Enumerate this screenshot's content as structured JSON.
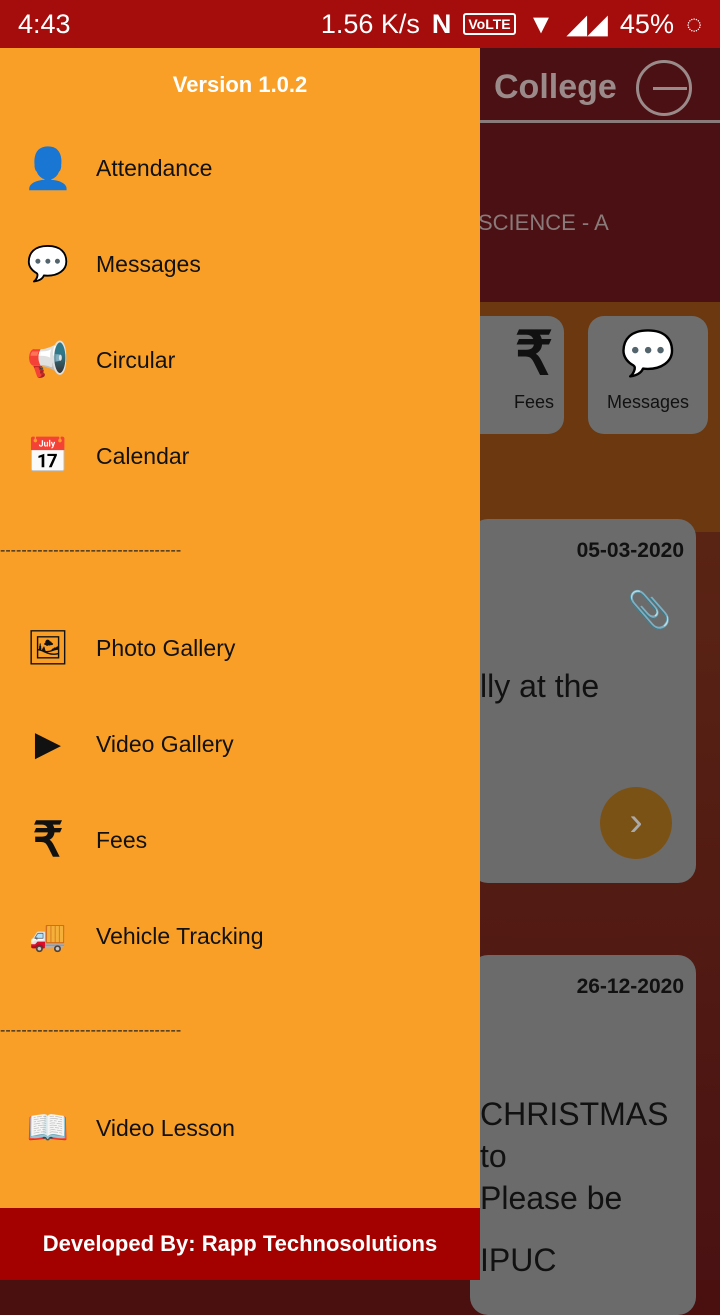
{
  "status_bar": {
    "time": "4:43",
    "net_speed": "1.56 K/s",
    "nfc": "N",
    "volte": "VoLTE",
    "battery": "45%"
  },
  "background": {
    "title": "College",
    "class_label": "SCIENCE - A",
    "tiles": [
      {
        "label": "Fees",
        "icon": "rupee-icon"
      },
      {
        "label": "Messages",
        "icon": "messages-icon"
      }
    ],
    "cards": [
      {
        "date": "05-03-2020",
        "text": "lly at the"
      },
      {
        "date": "26-12-2020",
        "lines": [
          "CHRISTMAS",
          "to",
          "Please be",
          "IPUC"
        ]
      }
    ]
  },
  "drawer": {
    "version": "Version 1.0.2",
    "group1": [
      {
        "label": "Attendance",
        "icon": "attendance-icon"
      },
      {
        "label": "Messages",
        "icon": "messages-icon"
      },
      {
        "label": "Circular",
        "icon": "megaphone-icon"
      },
      {
        "label": "Calendar",
        "icon": "calendar-icon"
      }
    ],
    "separator": "----------------------------------",
    "group2": [
      {
        "label": "Photo Gallery",
        "icon": "photo-gallery-icon"
      },
      {
        "label": "Video Gallery",
        "icon": "video-gallery-icon"
      },
      {
        "label": "Fees",
        "icon": "rupee-icon"
      },
      {
        "label": "Vehicle Tracking",
        "icon": "truck-icon"
      }
    ],
    "group3": [
      {
        "label": "Video Lesson",
        "icon": "video-lesson-icon"
      }
    ],
    "footer": "Developed By: Rapp Technosolutions"
  }
}
